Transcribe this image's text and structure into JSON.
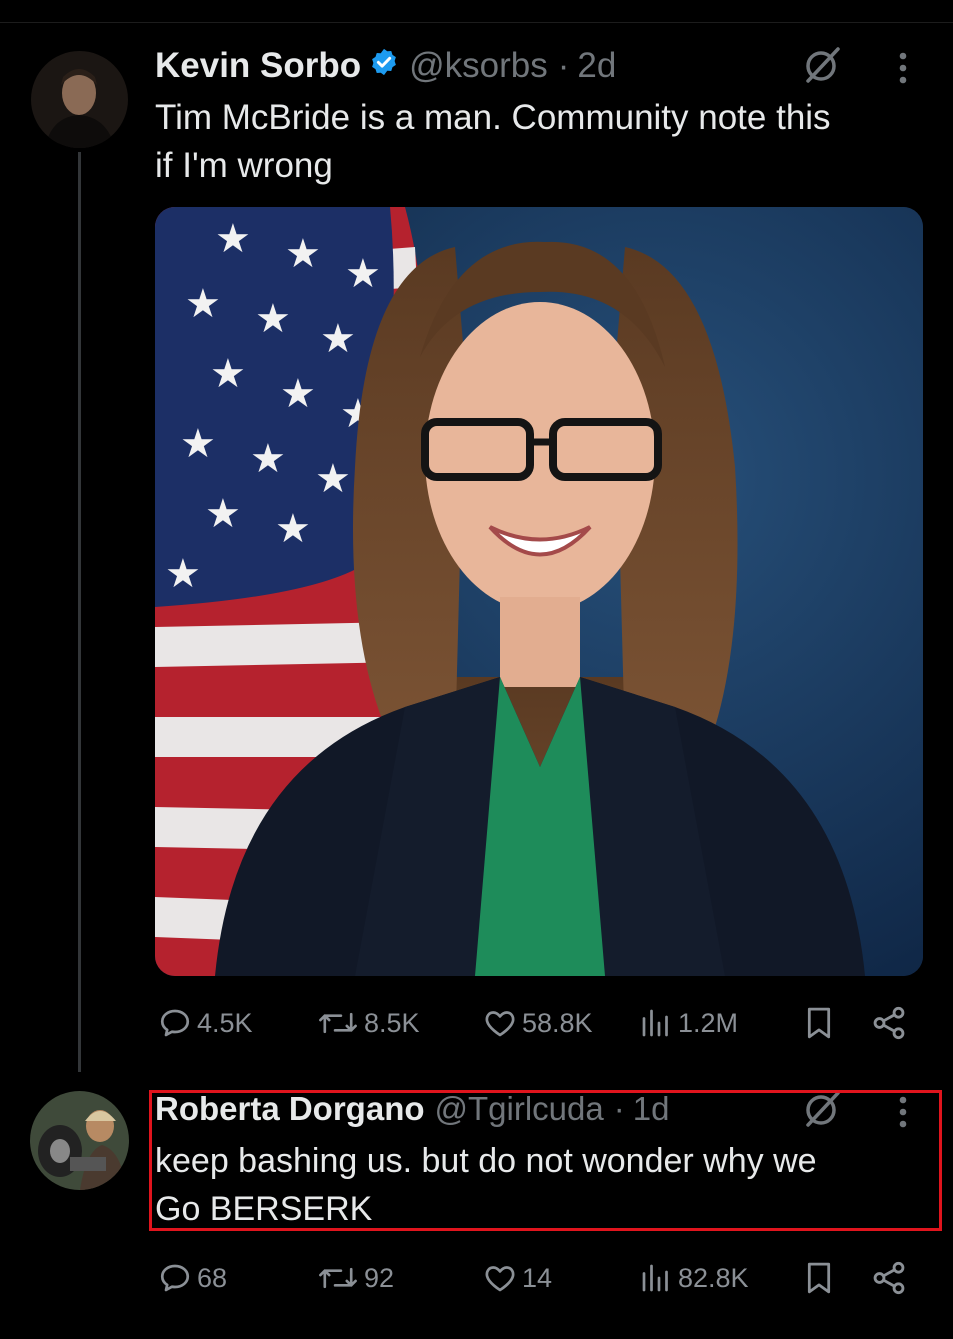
{
  "post": {
    "author_name": "Kevin Sorbo",
    "handle": "@ksorbs",
    "separator": "·",
    "time": "2d",
    "text_line1": "Tim McBride is a man. Community note this",
    "text_line2": "if I'm wrong",
    "media_icon": "portrait-photo",
    "stats": {
      "replies": "4.5K",
      "reposts": "8.5K",
      "likes": "58.8K",
      "views": "1.2M"
    }
  },
  "reply": {
    "author_name": "Roberta Dorgano",
    "handle": "@Tgirlcuda",
    "separator": "·",
    "time": "1d",
    "text_line1": "keep bashing us. but do not wonder why we",
    "text_line2": "Go BERSERK",
    "stats": {
      "replies": "68",
      "reposts": "92",
      "likes": "14",
      "views": "82.8K"
    }
  },
  "colors": {
    "background": "#000000",
    "text": "#e7e9ea",
    "muted": "#71767b",
    "verified": "#1d9bf0",
    "highlight_border": "#e0141d"
  },
  "icons": [
    "grok-icon",
    "more-icon",
    "reply-icon",
    "repost-icon",
    "like-icon",
    "views-icon",
    "bookmark-icon",
    "share-icon",
    "verified-badge-icon"
  ]
}
